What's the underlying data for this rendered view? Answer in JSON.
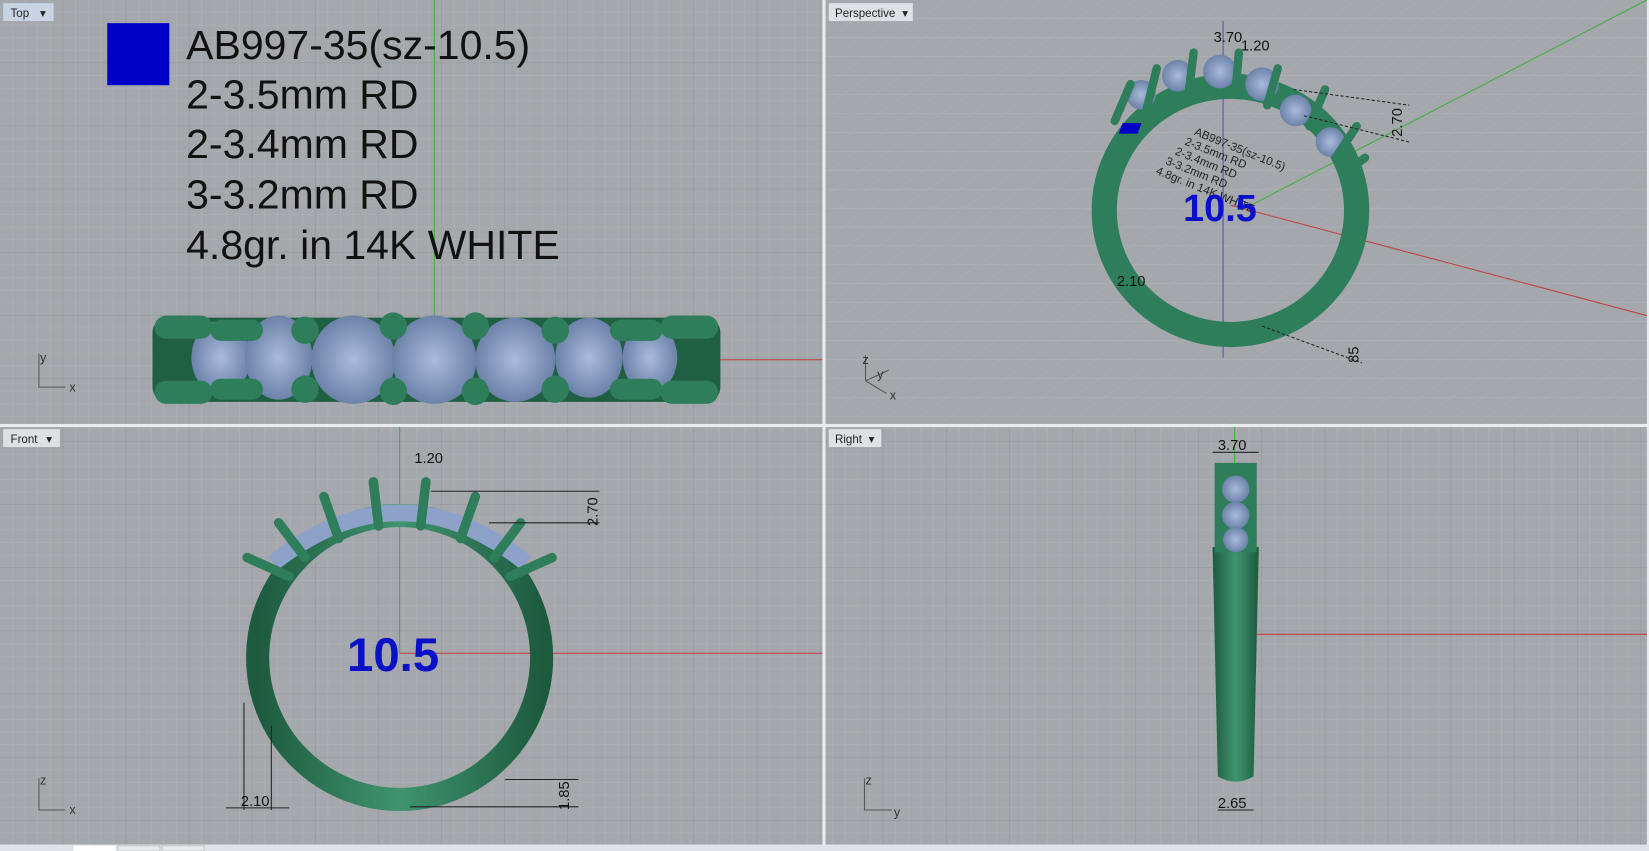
{
  "viewports": {
    "top": {
      "label": "Top"
    },
    "perspective": {
      "label": "Perspective"
    },
    "front": {
      "label": "Front"
    },
    "right": {
      "label": "Right"
    }
  },
  "annotation": {
    "lines": [
      "AB997-35(sz-10.5)",
      "2-3.5mm RD",
      "2-3.4mm RD",
      "3-3.2mm RD",
      "4.8gr. in 14K WHITE"
    ],
    "size": "10.5",
    "swatch_color": "#0000c8"
  },
  "dimensions": {
    "prong_width": "1.20",
    "head_height": "2.70",
    "top_width": "3.70",
    "shank_width": "2.10",
    "shank_bottom": "1.85",
    "bottom_width": "2.65",
    "persp_shank": "2.10",
    "persp_bottom": "85"
  },
  "axes": {
    "x": "x",
    "y": "y",
    "z": "z"
  },
  "colors": {
    "metal": "#2e7d5b",
    "stone": "#8da2c8",
    "background": "#a4a7ab",
    "x_axis": "#c04040",
    "y_axis": "#40b040"
  }
}
